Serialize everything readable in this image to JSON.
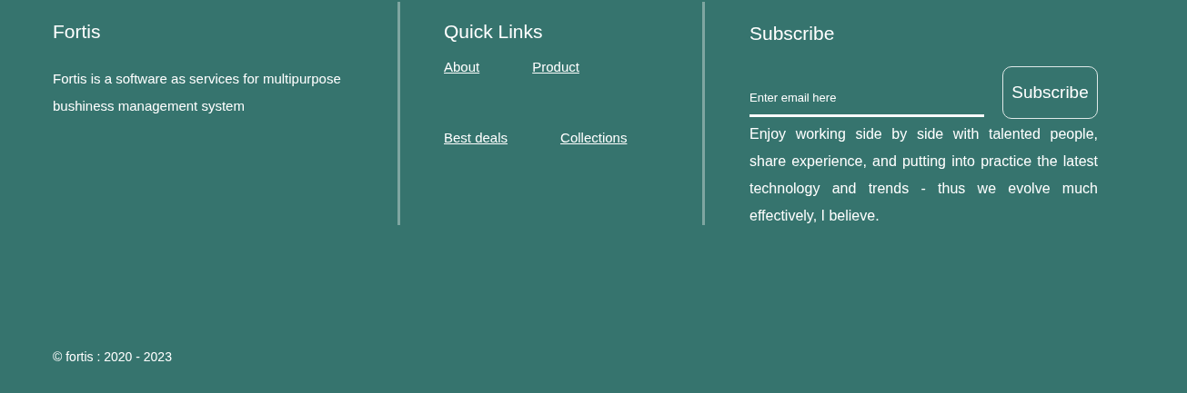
{
  "about": {
    "title": "Fortis",
    "text": "Fortis is a software as services for multipurpose bushiness management system"
  },
  "quick_links": {
    "title": "Quick Links",
    "rows": [
      [
        "About",
        "Product"
      ],
      [
        "Best deals",
        "Collections"
      ]
    ]
  },
  "subscribe": {
    "title": "Subscribe",
    "email": {
      "placeholder": "Enter email here"
    },
    "button": "Subscribe",
    "text": "Enjoy working side by side with talented people, share experience, and putting into practice the latest technology and trends - thus we evolve much effectively, I believe."
  },
  "copyright": "© fortis : 2020 - 2023"
}
